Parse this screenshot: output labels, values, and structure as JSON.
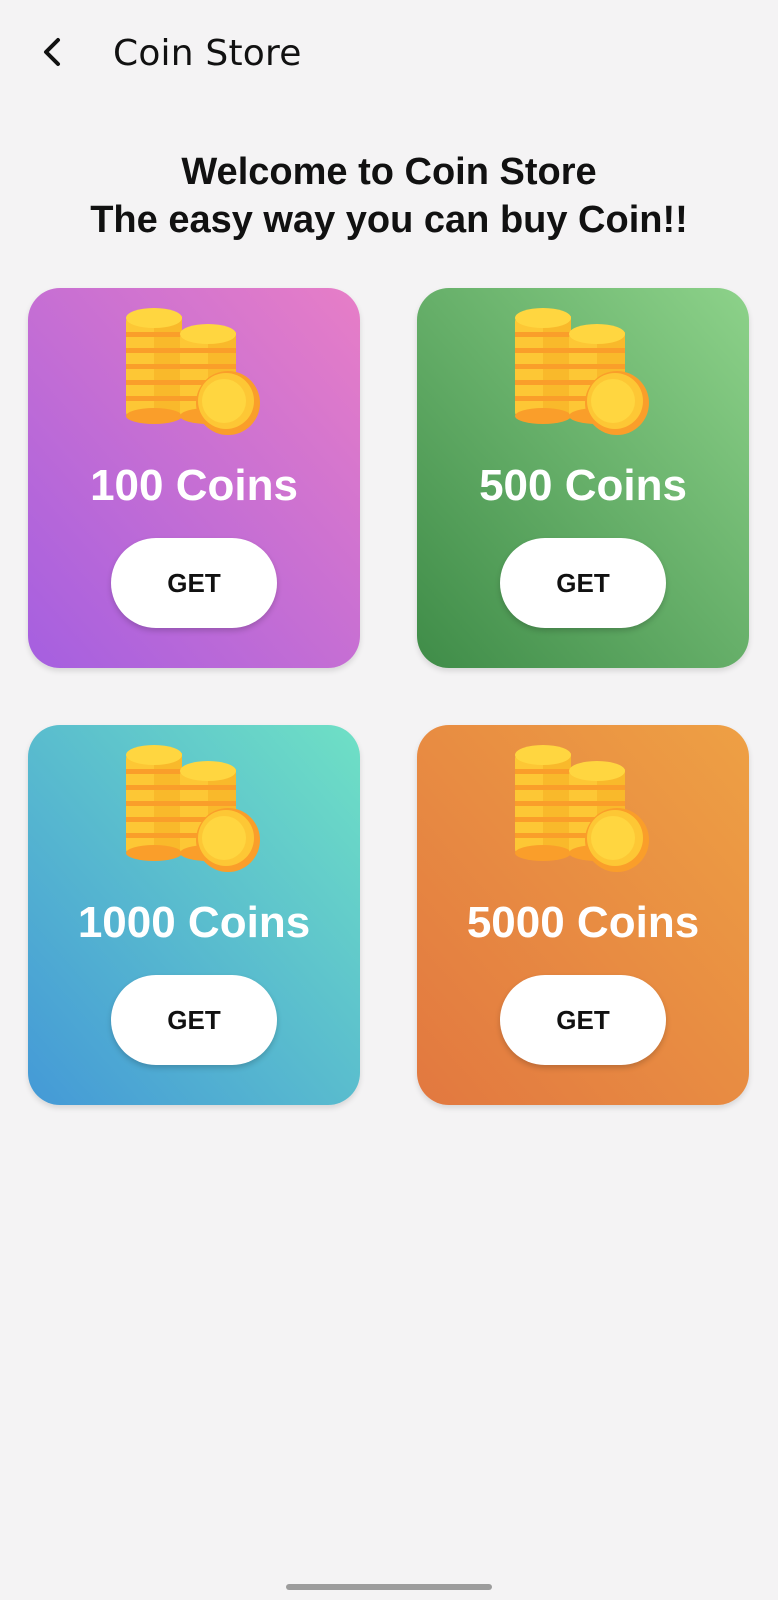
{
  "app_bar": {
    "title": "Coin Store",
    "back_icon": "chevron-left-icon"
  },
  "welcome": {
    "line1": "Welcome to Coin Store",
    "line2": "The easy way you can buy Coin!!"
  },
  "packages": [
    {
      "label": "100 Coins",
      "button": "GET",
      "gradient": [
        "#a55fe0",
        "#e77ec7"
      ]
    },
    {
      "label": "500 Coins",
      "button": "GET",
      "gradient": [
        "#3f8c48",
        "#8dd28a"
      ]
    },
    {
      "label": "1000 Coins",
      "button": "GET",
      "gradient": [
        "#4499d7",
        "#6fe0c5"
      ]
    },
    {
      "label": "5000 Coins",
      "button": "GET",
      "gradient": [
        "#e27840",
        "#eea044"
      ]
    }
  ],
  "colors": {
    "background": "#f4f3f4",
    "coin_gold": "#fdc735",
    "coin_orange": "#fa9e2a"
  },
  "icons": {
    "coin_stack": "coin-stack-icon"
  }
}
